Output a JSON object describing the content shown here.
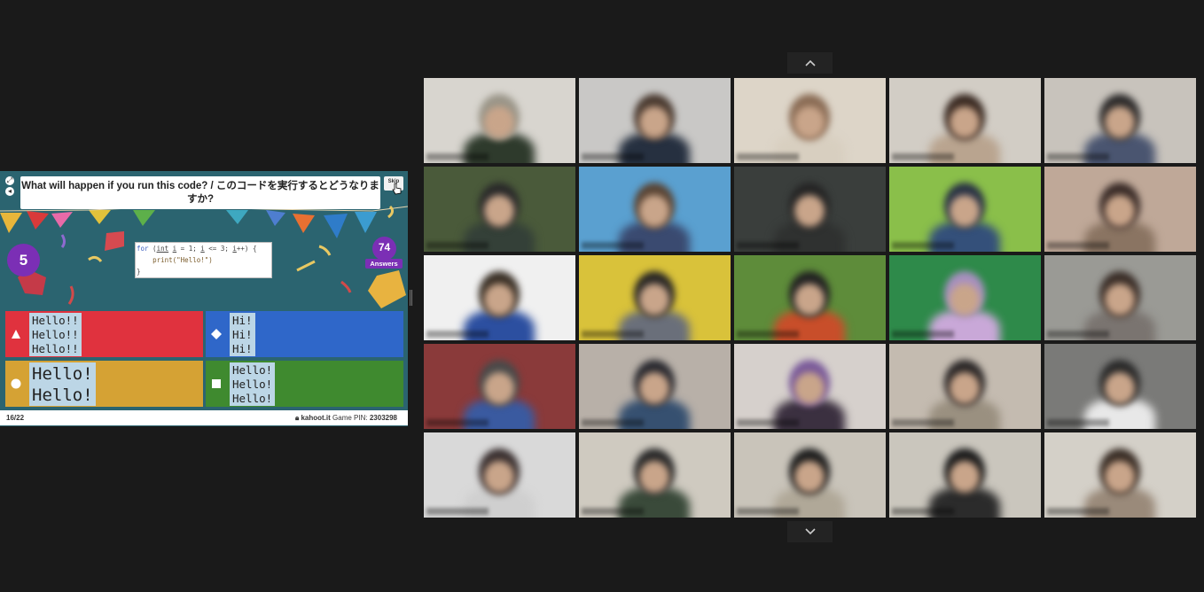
{
  "kahoot": {
    "question": "What will happen if you run this code? / このコードを実行するとどうなりますか?",
    "skip_label": "Skip",
    "timer": "5",
    "answers_count": "74",
    "answers_label": "Answers",
    "code_lines": [
      "for (int i = 1; i <= 3; i++) {",
      "    print(\"Hello!\")",
      "}"
    ],
    "options": [
      {
        "shape": "triangle",
        "color": "#e0323e",
        "text": "Hello!!\nHello!!\nHello!!"
      },
      {
        "shape": "diamond",
        "color": "#2f67c9",
        "text": "Hi!\nHi!\nHi!"
      },
      {
        "shape": "circle",
        "color": "#d5a234",
        "text": "Hello!\nHello!"
      },
      {
        "shape": "square",
        "color": "#3f8a2f",
        "text": "Hello!\nHello!\nHello!"
      }
    ],
    "progress": "16/22",
    "site": "kahoot.it",
    "pin_label": "Game PIN:",
    "pin": "2303298"
  },
  "grid": {
    "up_arrow": "^",
    "down_arrow": "v",
    "participant_count": 25
  },
  "colors": {
    "background": "#1a1a1a",
    "kahoot_bg": "#2b6470",
    "purple": "#7b2fb5"
  }
}
